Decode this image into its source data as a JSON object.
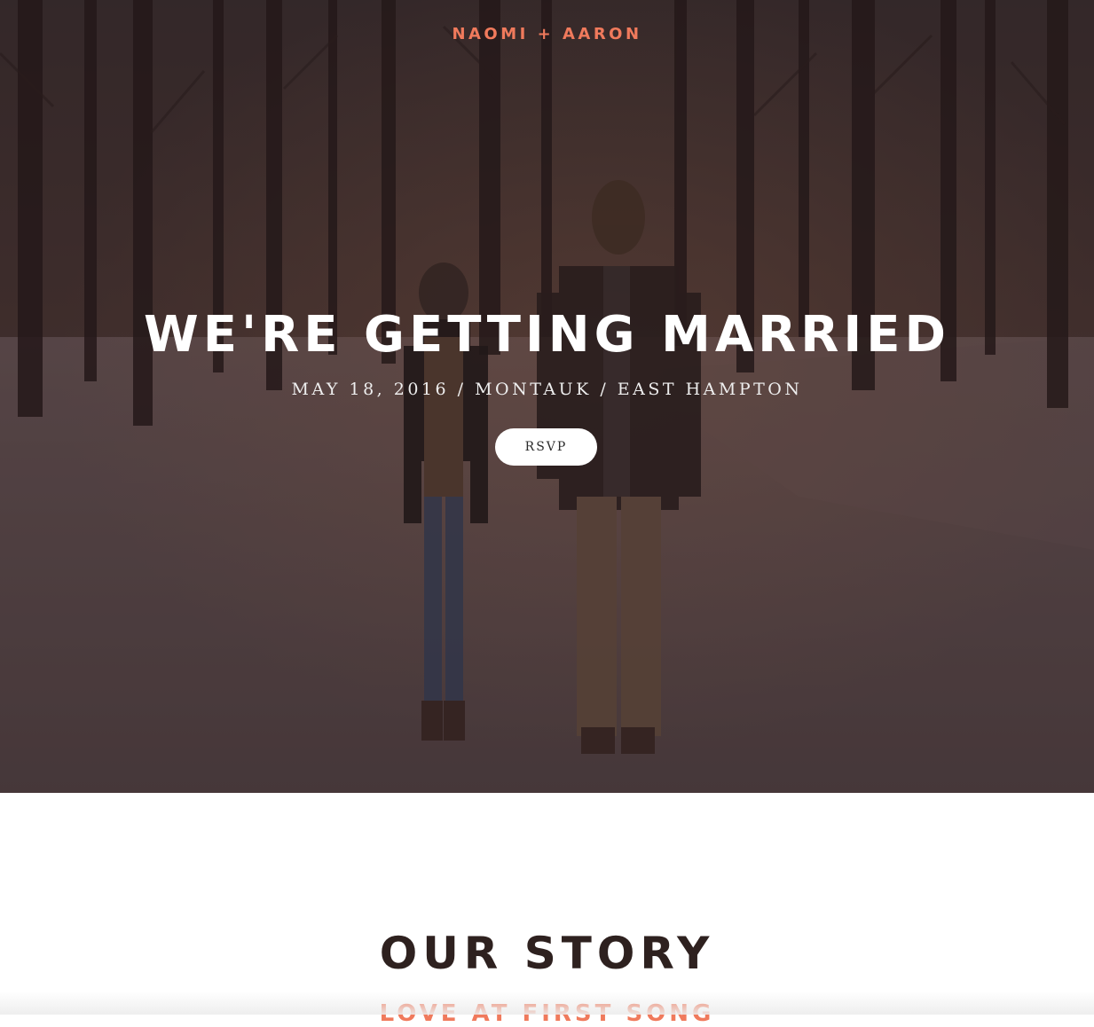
{
  "header": {
    "brand": "NAOMI + AARON"
  },
  "hero": {
    "title": "WE'RE GETTING MARRIED",
    "subtitle": "MAY 18, 2016 / MONTAUK / EAST HAMPTON",
    "rsvp_label": "RSVP"
  },
  "story": {
    "title": "OUR STORY",
    "subtitle": "LOVE AT FIRST SONG"
  },
  "colors": {
    "accent": "#f07a5c",
    "heading_dark": "#2e211f",
    "hero_text": "#ffffff"
  }
}
